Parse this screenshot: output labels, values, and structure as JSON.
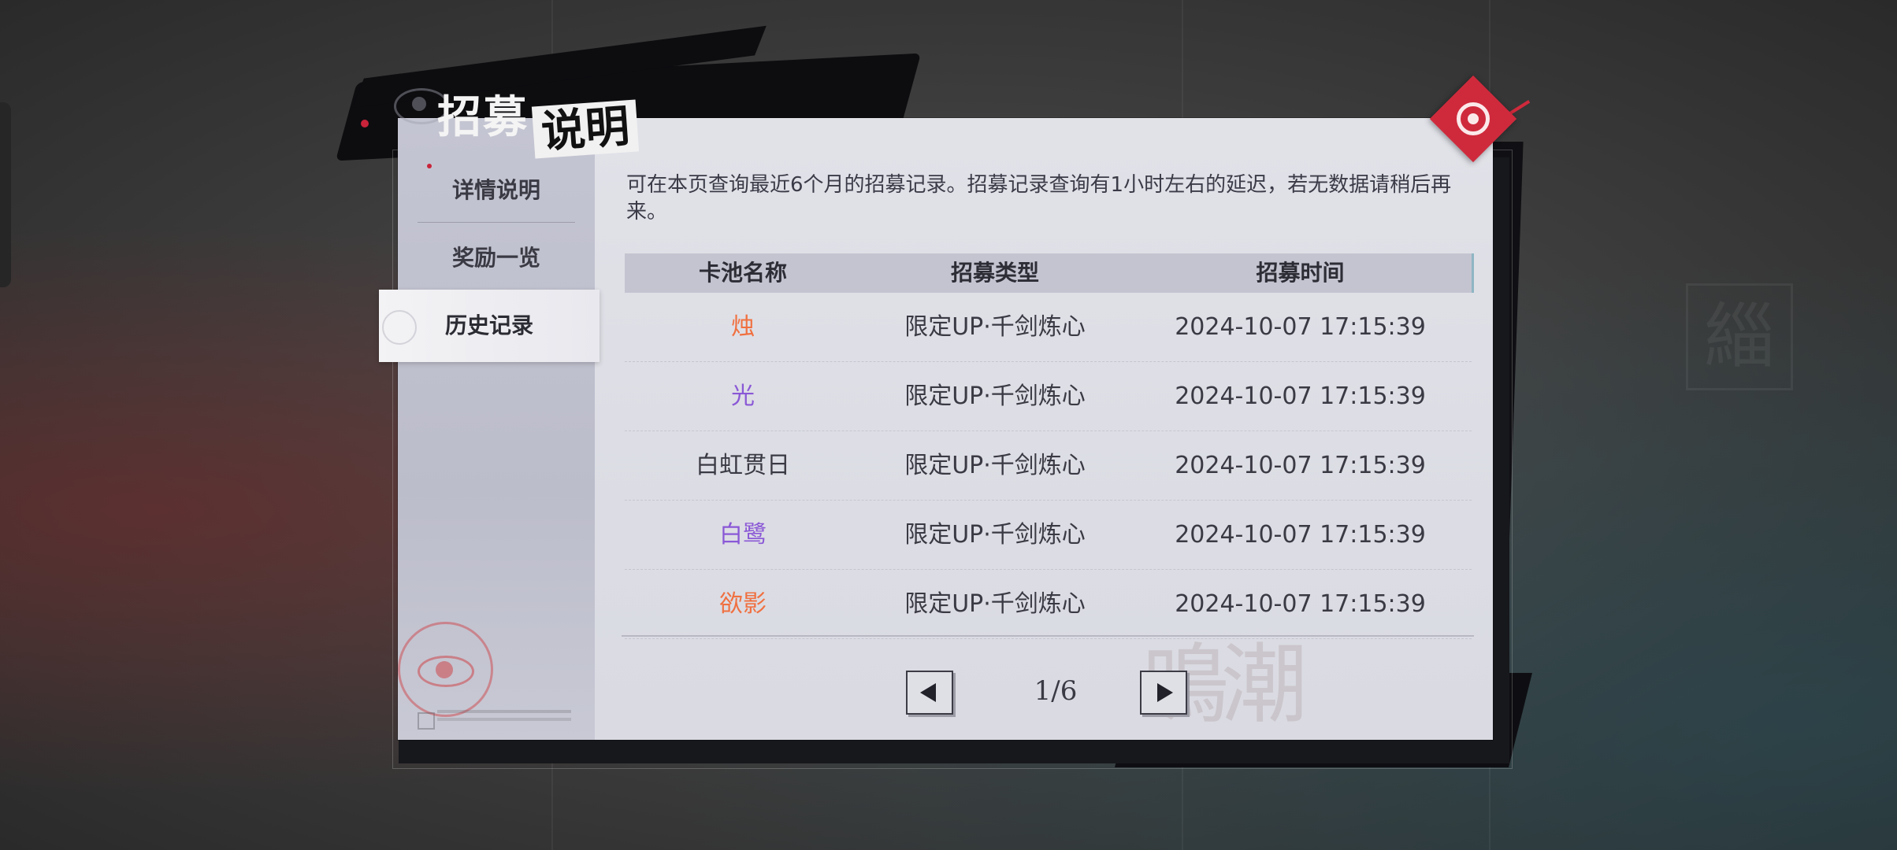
{
  "header": {
    "title_part1": "招募",
    "title_part2": "说明"
  },
  "sidebar": {
    "items": [
      {
        "label": "详情说明",
        "active": false
      },
      {
        "label": "奖励一览",
        "active": false
      },
      {
        "label": "历史记录",
        "active": true
      }
    ]
  },
  "notice": "可在本页查询最近6个月的招募记录。招募记录查询有1小时左右的延迟，若无数据请稍后再来。",
  "table": {
    "headers": [
      "卡池名称",
      "招募类型",
      "招募时间"
    ],
    "rows": [
      {
        "name": "烛",
        "name_color": "#f07040",
        "type": "限定UP·千剑炼心",
        "time": "2024-10-07 17:15:39"
      },
      {
        "name": "光",
        "name_color": "#8a58d6",
        "type": "限定UP·千剑炼心",
        "time": "2024-10-07 17:15:39"
      },
      {
        "name": "白虹贯日",
        "name_color": "#3a3a44",
        "type": "限定UP·千剑炼心",
        "time": "2024-10-07 17:15:39"
      },
      {
        "name": "白鹭",
        "name_color": "#8a58d6",
        "type": "限定UP·千剑炼心",
        "time": "2024-10-07 17:15:39"
      },
      {
        "name": "欲影",
        "name_color": "#f07040",
        "type": "限定UP·千剑炼心",
        "time": "2024-10-07 17:15:39"
      }
    ]
  },
  "pagination": {
    "label": "1/6",
    "current": 1,
    "total": 6
  },
  "icons": {
    "prev": "arrow-left-icon",
    "next": "arrow-right-icon",
    "close": "close-eye-icon",
    "seal": "eye-seal-icon"
  },
  "colors": {
    "accent_red": "#cf2a3c",
    "rarity_orange": "#f07040",
    "rarity_purple": "#8a58d6"
  }
}
